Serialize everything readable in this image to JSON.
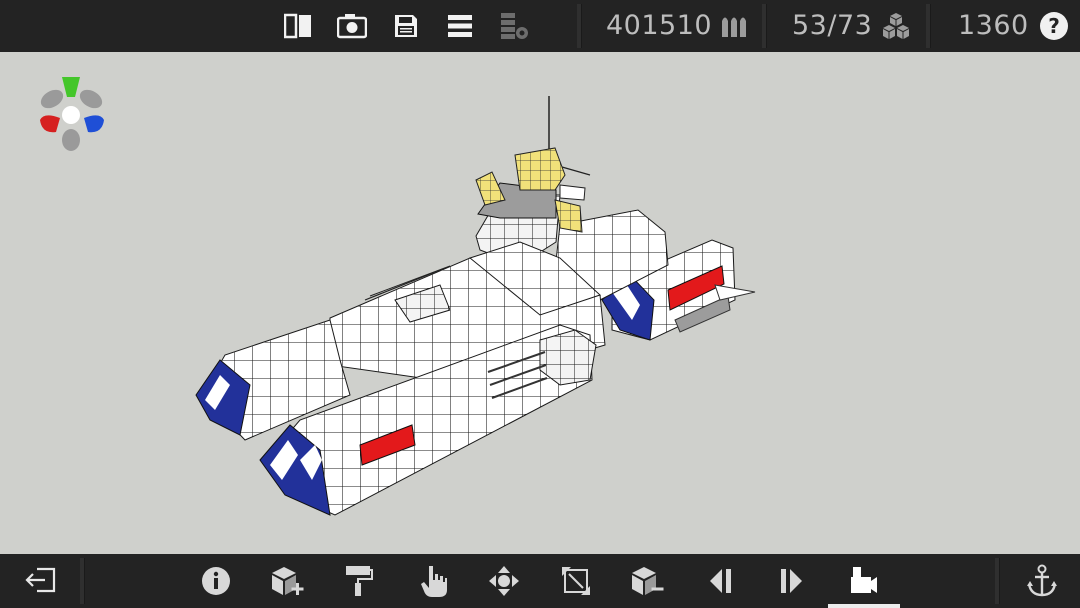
{
  "topbar": {
    "icons": [
      "split-view-icon",
      "camera-icon",
      "save-icon",
      "menu-icon",
      "block-stack-icon"
    ],
    "cost_value": "401510",
    "ammo_icon": "ammo-icon",
    "blocks_value": "53/73",
    "blocks_icon": "cubes-icon",
    "mass_value": "1360",
    "help_label": "?"
  },
  "bottombar": {
    "tools": [
      "exit-icon",
      "info-icon",
      "add-block-icon",
      "paint-roller-icon",
      "hand-icon",
      "move-icon",
      "resize-icon",
      "remove-block-icon",
      "prev-icon",
      "next-icon",
      "camera-view-icon",
      "anchor-icon"
    ],
    "active_tool": "camera-view-icon"
  },
  "colors": {
    "bar_bg": "#232323",
    "viewport_bg": "#cfd0cc",
    "hull_white": "#ffffff",
    "stripe_blue": "#22319a",
    "stripe_red": "#e3191b",
    "turret_yellow": "#f1e17a",
    "axis_green": "#44c62a",
    "axis_red": "#d62020",
    "axis_blue": "#1f4fd6"
  }
}
